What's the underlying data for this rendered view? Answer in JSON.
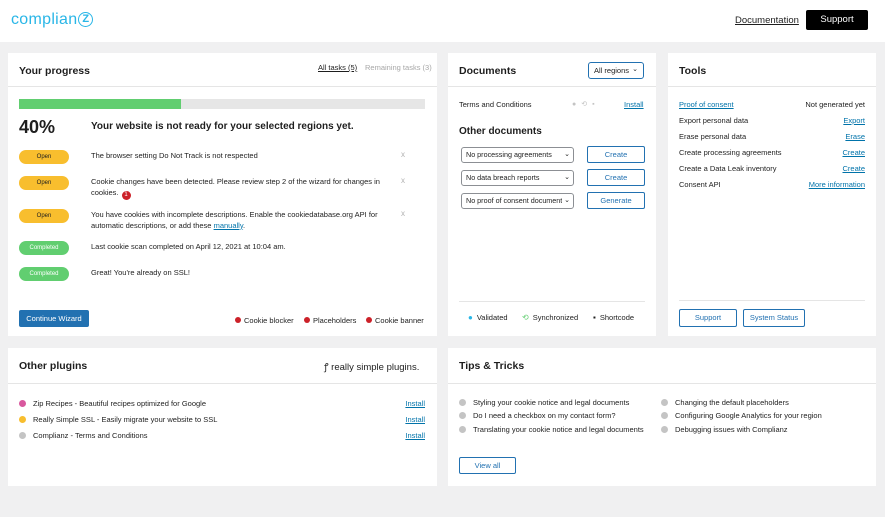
{
  "header": {
    "logo_text": "complian",
    "logo_mark": "Z",
    "documentation": "Documentation",
    "support": "Support"
  },
  "progress": {
    "title": "Your progress",
    "tab_all": "All tasks (5)",
    "tab_remaining": "Remaining tasks (3)",
    "percent_value": 0.4,
    "percent_text": "40%",
    "message": "Your website is not ready for your selected regions yet.",
    "tasks": [
      {
        "status": "Open",
        "text": "The browser setting Do Not Track is not respected",
        "dismiss": "x"
      },
      {
        "status": "Open",
        "text": "Cookie changes have been detected. Please review step 2 of the wizard for changes in cookies.",
        "notice": "1",
        "dismiss": "x"
      },
      {
        "status": "Open",
        "text": "You have cookies with incomplete descriptions. Enable the cookiedatabase.org API for automatic descriptions, or add these ",
        "link": "manually",
        "text_end": ".",
        "dismiss": "x"
      },
      {
        "status": "Completed",
        "text": "Last cookie scan completed on April 12, 2021 at 10:04 am."
      },
      {
        "status": "Completed",
        "text": "Great! You're already on SSL!"
      }
    ],
    "wizard_button": "Continue Wizard",
    "legend": [
      "Cookie blocker",
      "Placeholders",
      "Cookie banner"
    ]
  },
  "documents": {
    "title": "Documents",
    "region_select": "All regions",
    "terms_label": "Terms and Conditions",
    "terms_install": "Install",
    "other_title": "Other documents",
    "rows": [
      {
        "select": "No processing agreements",
        "button": "Create"
      },
      {
        "select": "No data breach reports",
        "button": "Create"
      },
      {
        "select": "No proof of consent documents",
        "button": "Generate"
      }
    ],
    "status": [
      "Validated",
      "Synchronized",
      "Shortcode"
    ]
  },
  "tools": {
    "title": "Tools",
    "rows": [
      {
        "label": "Proof of consent",
        "value": "Not generated yet"
      },
      {
        "label": "Export personal data",
        "value": "Export"
      },
      {
        "label": "Erase personal data",
        "value": "Erase"
      },
      {
        "label": "Create processing agreements",
        "value": "Create"
      },
      {
        "label": "Create a Data Leak inventory",
        "value": "Create"
      },
      {
        "label": "Consent API",
        "value": "More information"
      }
    ],
    "support_button": "Support",
    "system_status_button": "System Status"
  },
  "plugins": {
    "title": "Other plugins",
    "brand": "really simple plugins.",
    "items": [
      {
        "name": "Zip Recipes - Beautiful recipes optimized for Google",
        "action": "Install",
        "color": "#d8589e"
      },
      {
        "name": "Really Simple SSL - Easily migrate your website to SSL",
        "action": "Install",
        "color": "#f8be2e"
      },
      {
        "name": "Complianz - Terms and Conditions",
        "action": "Install",
        "color": "#c4c4c4"
      }
    ]
  },
  "tips": {
    "title": "Tips & Tricks",
    "left": [
      "Styling your cookie notice and legal documents",
      "Do I need a checkbox on my contact form?",
      "Translating your cookie notice and legal documents"
    ],
    "right": [
      "Changing the default placeholders",
      "Configuring Google Analytics for your region",
      "Debugging issues with Complianz"
    ],
    "view_all": "View all"
  },
  "colors": {
    "accent": "#2271b1",
    "open": "#f8be2e",
    "completed": "#61ce70",
    "error": "#cc2129"
  }
}
